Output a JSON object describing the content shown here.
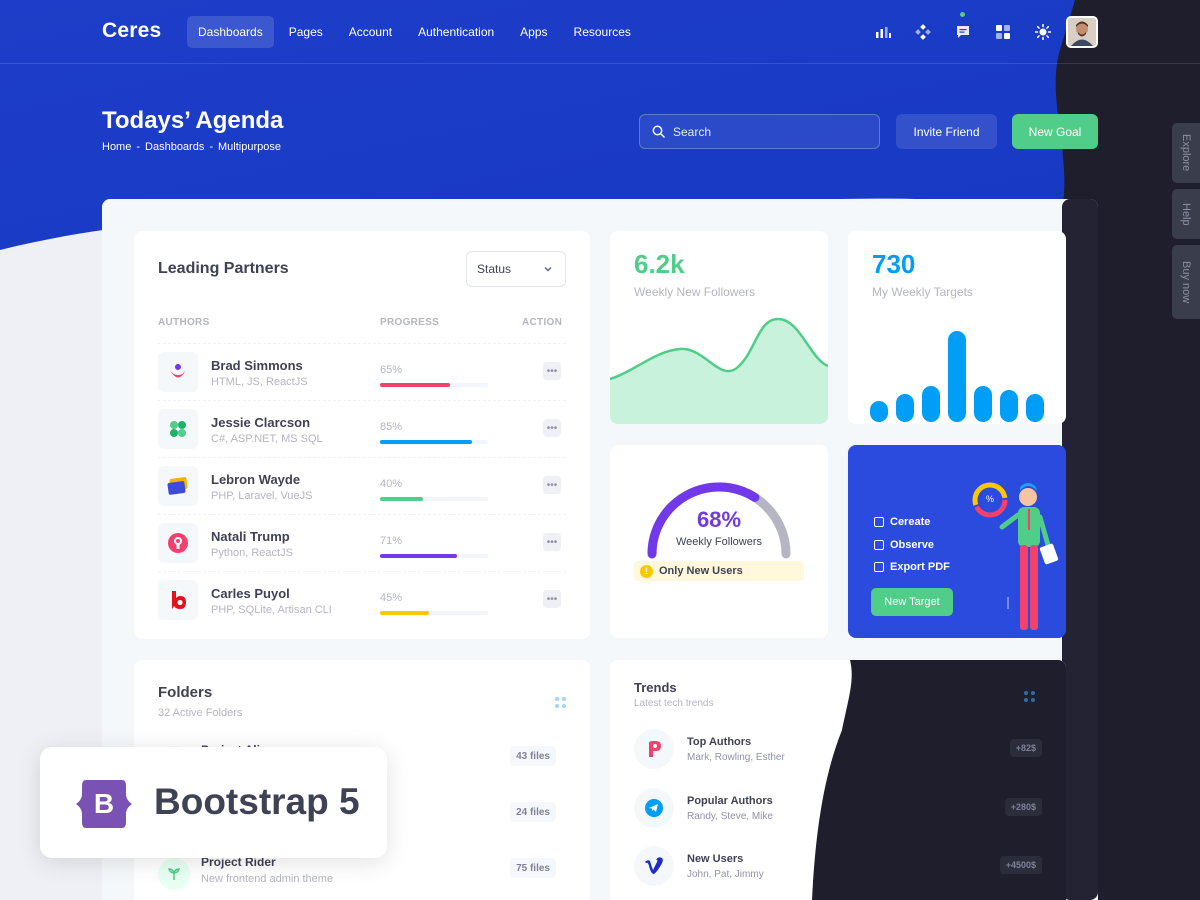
{
  "app": {
    "logo": "Ceres"
  },
  "nav": {
    "items": [
      {
        "label": "Dashboards",
        "active": true
      },
      {
        "label": "Pages"
      },
      {
        "label": "Account"
      },
      {
        "label": "Authentication"
      },
      {
        "label": "Apps"
      },
      {
        "label": "Resources"
      }
    ],
    "icons": [
      "bar-chart-icon",
      "apps-grid-icon",
      "chat-icon",
      "dashboard-layout-icon",
      "theme-sun-icon"
    ]
  },
  "header": {
    "title": "Todays’ Agenda",
    "breadcrumb": [
      "Home",
      "-",
      "Dashboards",
      "-",
      "Multipurpose"
    ],
    "search_placeholder": "Search",
    "invite_label": "Invite Friend",
    "goal_label": "New Goal"
  },
  "side_tabs": [
    "Explore",
    "Help",
    "Buy now"
  ],
  "leading_partners": {
    "title": "Leading Partners",
    "status_select": "Status",
    "columns": [
      "AUTHORS",
      "PROGRESS",
      "ACTION"
    ],
    "rows": [
      {
        "name": "Brad Simmons",
        "skills": "HTML, JS, ReactJS",
        "progress": "65%",
        "value": 0.65,
        "color": "#f1416c"
      },
      {
        "name": "Jessie Clarcson",
        "skills": "C#, ASP.NET, MS SQL",
        "progress": "85%",
        "value": 0.85,
        "color": "#009ef7"
      },
      {
        "name": "Lebron Wayde",
        "skills": "PHP, Laravel, VueJS",
        "progress": "40%",
        "value": 0.4,
        "color": "#50cd89"
      },
      {
        "name": "Natali Trump",
        "skills": "Python, ReactJS",
        "progress": "71%",
        "value": 0.71,
        "color": "#7239ea"
      },
      {
        "name": "Carles Puyol",
        "skills": "PHP, SQLite, Artisan CLI",
        "progress": "45%",
        "value": 0.45,
        "color": "#ffc700"
      }
    ],
    "action_glyph": "•••"
  },
  "followers": {
    "value": "6.2k",
    "label": "Weekly New Followers",
    "accent": "#50cd89"
  },
  "targets": {
    "value": "730",
    "label": "My Weekly Targets",
    "accent": "#009ef7"
  },
  "gauge": {
    "value": "68%",
    "fraction": 0.68,
    "label": "Weekly Followers",
    "note": "Only New Users",
    "accent": "#7239ea"
  },
  "blue_card": {
    "items": [
      "Cereate",
      "Observe",
      "Export PDF"
    ],
    "button": "New Target",
    "badge": "%"
  },
  "folders": {
    "title": "Folders",
    "subtitle": "32 Active Folders",
    "rows": [
      {
        "name": "Project Alice",
        "desc": "",
        "count": "43 files"
      },
      {
        "name": "",
        "desc": "",
        "count": "24 files"
      },
      {
        "name": "Project Rider",
        "desc": "New frontend admin theme",
        "count": "75 files"
      }
    ]
  },
  "trends": {
    "title": "Trends",
    "subtitle": "Latest tech trends",
    "rows": [
      {
        "name": "Top Authors",
        "desc": "Mark, Rowling, Esther",
        "value": "+82$"
      },
      {
        "name": "Popular Authors",
        "desc": "Randy, Steve, Mike",
        "value": "+280$"
      },
      {
        "name": "New Users",
        "desc": "John, Pat, Jimmy",
        "value": "+4500$"
      }
    ]
  },
  "badge": {
    "text": "Bootstrap 5",
    "letter": "B"
  }
}
